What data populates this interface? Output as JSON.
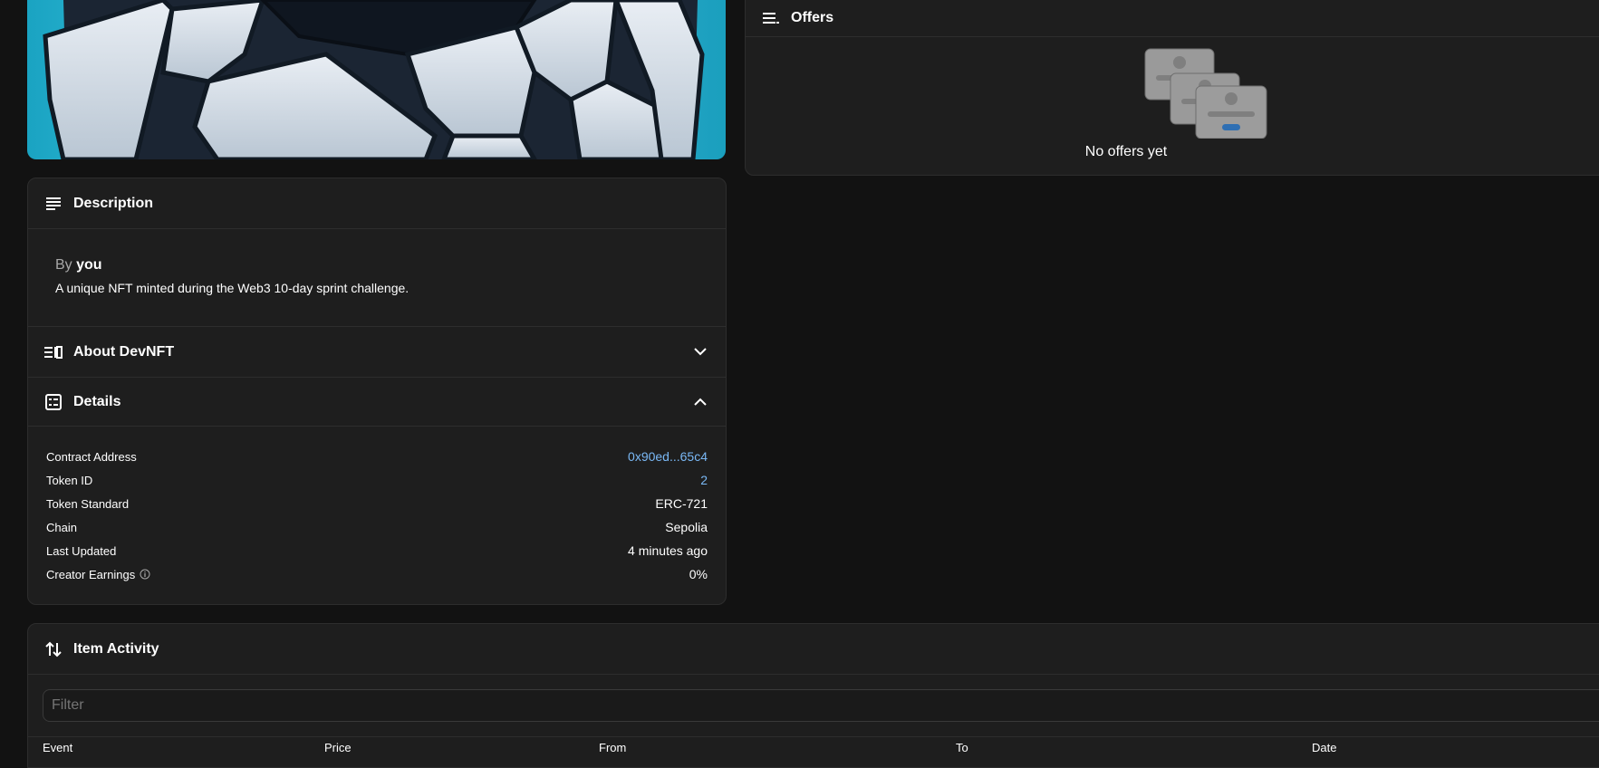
{
  "offers": {
    "title": "Offers",
    "empty_text": "No offers yet"
  },
  "description": {
    "title": "Description",
    "by_prefix": "By",
    "by_name": "you",
    "text": "A unique NFT minted during the Web3 10-day sprint challenge."
  },
  "about": {
    "title": "About DevNFT"
  },
  "details": {
    "title": "Details",
    "rows": [
      {
        "label": "Contract Address",
        "value": "0x90ed...65c4"
      },
      {
        "label": "Token ID",
        "value": "2"
      },
      {
        "label": "Token Standard",
        "value": "ERC-721"
      },
      {
        "label": "Chain",
        "value": "Sepolia"
      },
      {
        "label": "Last Updated",
        "value": "4 minutes ago"
      },
      {
        "label": "Creator Earnings",
        "value": "0%"
      }
    ]
  },
  "activity": {
    "title": "Item Activity",
    "filter_placeholder": "Filter",
    "columns": [
      "Event",
      "Price",
      "From",
      "To",
      "Date"
    ]
  },
  "colors": {
    "background": "#121212",
    "panel": "#1e1e1e",
    "link": "#7ab8f5",
    "image_bg": "#1aa3c2"
  },
  "icons": {
    "offers": "list-icon",
    "description": "text-lines-icon",
    "about": "book-list-icon",
    "details": "checklist-icon",
    "activity": "arrows-up-down-icon"
  }
}
